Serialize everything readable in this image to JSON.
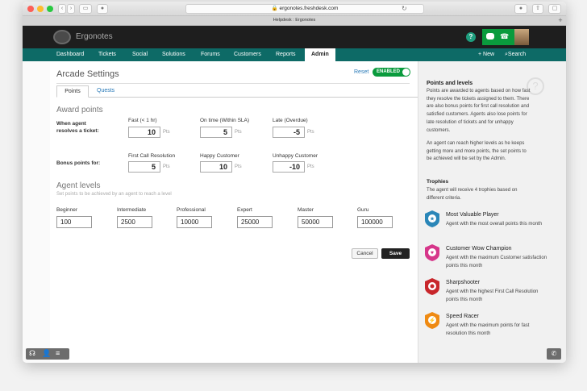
{
  "browser": {
    "url": "ergonotes.freshdesk.com",
    "tab_title": "Helpdesk : Ergonotes"
  },
  "app": {
    "brand": "Ergonotes",
    "help_label": "?",
    "nav": [
      "Dashboard",
      "Tickets",
      "Social",
      "Solutions",
      "Forums",
      "Customers",
      "Reports",
      "Admin"
    ],
    "new_label": "+ New",
    "search_label": "Search"
  },
  "page": {
    "title": "Arcade Settings",
    "reset_label": "Reset",
    "toggle_label": "ENABLED",
    "tabs": [
      "Points",
      "Quests"
    ],
    "award_heading": "Award points",
    "resolve_label": "When agent resolves a ticket:",
    "bonus_label": "Bonus points for:",
    "pts": "Pts",
    "resolve_cols": [
      {
        "label": "Fast (< 1 hr)",
        "value": "10"
      },
      {
        "label": "On time (Within SLA)",
        "value": "5"
      },
      {
        "label": "Late (Overdue)",
        "value": "-5"
      }
    ],
    "bonus_cols": [
      {
        "label": "First Call Resolution",
        "value": "5"
      },
      {
        "label": "Happy Customer",
        "value": "10"
      },
      {
        "label": "Unhappy Customer",
        "value": "-10"
      }
    ],
    "levels_heading": "Agent levels",
    "levels_sub": "Set points to be achieved by an agent to reach a level",
    "levels": [
      {
        "name": "Beginner",
        "value": "100"
      },
      {
        "name": "Intermediate",
        "value": "2500"
      },
      {
        "name": "Professional",
        "value": "10000"
      },
      {
        "name": "Expert",
        "value": "25000"
      },
      {
        "name": "Master",
        "value": "50000"
      },
      {
        "name": "Guru",
        "value": "100000"
      }
    ],
    "cancel_label": "Cancel",
    "save_label": "Save"
  },
  "sidebar": {
    "heading": "Points and levels",
    "p1": "Points are awarded to agents based on how fast they resolve the tickets assigned to them. There are also bonus points for first call resolution and satisfied customers. Agents also lose points for late resolution of tickets and for unhappy customers.",
    "p2": "An agent can reach higher levels as he keeps getting more and more points, the set points to be achieved will be set by the Admin.",
    "trophies_heading": "Trophies",
    "trophies_intro": "The agent will receive 4 trophies based on different criteria.",
    "trophies": [
      {
        "name": "Most Valuable Player",
        "desc": "Agent with the most overall points this month",
        "color": "#2a86b8"
      },
      {
        "name": "Customer Wow Champion",
        "desc": "Agent with the maximum Customer satisfaction points this month",
        "color": "#d6368a"
      },
      {
        "name": "Sharpshooter",
        "desc": "Agent with the highest First Call Resolution points this month",
        "color": "#c8262b"
      },
      {
        "name": "Speed Racer",
        "desc": "Agent with the maximum points for fast resolution this month",
        "color": "#ef8a12"
      }
    ]
  },
  "colors": {
    "nav": "#0d6a66",
    "accent": "#0a9b3d",
    "link": "#2a7ab8",
    "save": "#222222"
  }
}
